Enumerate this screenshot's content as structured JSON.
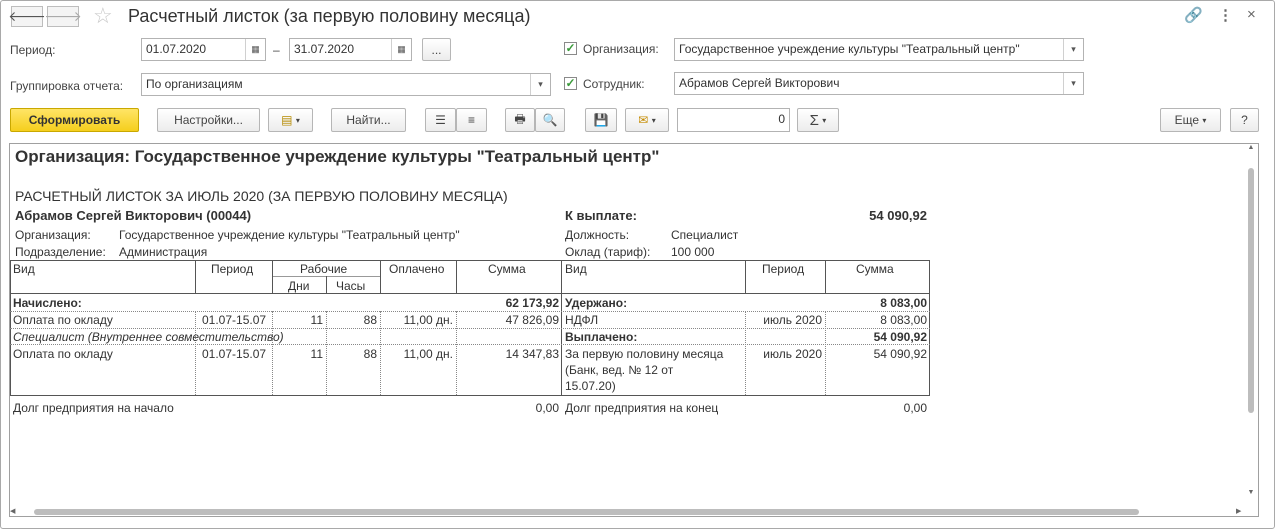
{
  "window": {
    "title": "Расчетный листок (за первую половину месяца)",
    "back_icon": "arrow-left-icon",
    "forward_icon": "arrow-right-icon",
    "link_icon": "link-icon",
    "more_icon": "vertical-dots-icon",
    "close_icon": "close-icon"
  },
  "form": {
    "period_label": "Период:",
    "period_from": "01.07.2020",
    "period_dash": "–",
    "period_to": "31.07.2020",
    "period_more": "...",
    "grouping_label": "Группировка отчета:",
    "grouping_value": "По организациям",
    "org_checked": "✓",
    "org_label": "Организация:",
    "org_value": "Государственное учреждение культуры \"Театральный центр\"",
    "employee_checked": "✓",
    "employee_label": "Сотрудник:",
    "employee_value": "Абрамов Сергей Викторович"
  },
  "toolbar": {
    "generate": "Сформировать",
    "settings": "Настройки...",
    "find": "Найти...",
    "number_value": "0",
    "sum_symbol": "Σ",
    "more": "Еще",
    "help": "?"
  },
  "report": {
    "org_header": "Организация: Государственное учреждение культуры \"Театральный центр\"",
    "doc_title": "РАСЧЕТНЫЙ ЛИСТОК ЗА ИЮЛЬ 2020 (ЗА ПЕРВУЮ ПОЛОВИНУ МЕСЯЦА)",
    "employee": "Абрамов Сергей Викторович (00044)",
    "to_pay_label": "К выплате:",
    "to_pay_value": "54 090,92",
    "org_label": "Организация:",
    "org_value": "Государственное учреждение культуры \"Театральный центр\"",
    "dept_label": "Подразделение:",
    "dept_value": "Администрация",
    "position_label": "Должность:",
    "position_value": "Специалист",
    "salary_label": "Оклад (тариф):",
    "salary_value": "100 000",
    "left_headers": {
      "kind": "Вид",
      "period": "Период",
      "working": "Рабочие",
      "days": "Дни",
      "hours": "Часы",
      "paid": "Оплачено",
      "sum": "Сумма"
    },
    "right_headers": {
      "kind": "Вид",
      "period": "Период",
      "sum": "Сумма"
    },
    "accrued_label": "Начислено:",
    "accrued_total": "62 173,92",
    "accrued_rows": [
      {
        "kind": "Оплата по окладу",
        "period": "01.07-15.07",
        "days": "11",
        "hours": "88",
        "paid": "11,00 дн.",
        "sum": "47 826,09"
      },
      {
        "kind": "Оплата по окладу",
        "period": "01.07-15.07",
        "days": "11",
        "hours": "88",
        "paid": "11,00 дн.",
        "sum": "14 347,83"
      }
    ],
    "section_label": "Специалист (Внутреннее совместительство)",
    "withheld_label": "Удержано:",
    "withheld_total": "8 083,00",
    "withheld_row": {
      "kind": "НДФЛ",
      "period": "июль 2020",
      "sum": "8 083,00"
    },
    "paid_out_label": "Выплачено:",
    "paid_out_total": "54 090,92",
    "paid_out_row": {
      "kind_lines": [
        "За первую половину месяца",
        "(Банк, вед. № 12 от",
        "15.07.20)"
      ],
      "period": "июль 2020",
      "sum": "54 090,92"
    },
    "debt_start_label": "Долг предприятия на начало",
    "debt_start_value": "0,00",
    "debt_end_label": "Долг предприятия на конец",
    "debt_end_value": "0,00"
  }
}
